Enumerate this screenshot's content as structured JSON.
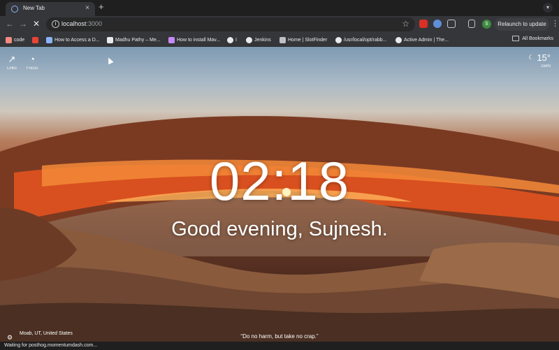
{
  "browser": {
    "tab": {
      "title": "New Tab",
      "close_glyph": "×"
    },
    "new_tab_glyph": "+",
    "tab_search_glyph": "▾",
    "nav": {
      "back": "←",
      "forward": "→",
      "stop": "✕"
    },
    "omnibox": {
      "info_glyph": "i",
      "host": "localhost",
      "port": ":3000",
      "star_glyph": "☆"
    },
    "profile_initial": "S",
    "relaunch_label": "Relaunch to update",
    "menu_glyph": "⋮",
    "bookmarks": [
      {
        "label": "code",
        "icon": "code-icon",
        "color": "#f28b82"
      },
      {
        "label": "",
        "icon": "red-app-icon",
        "color": "#ea4335"
      },
      {
        "label": "How to Access a D...",
        "icon": "link-icon",
        "color": "#8ab4f8"
      },
      {
        "label": "Madhu Pathy – Me...",
        "icon": "medium-icon",
        "color": "#e8eaed"
      },
      {
        "label": "How to install Mav...",
        "icon": "page-icon",
        "color": "#c58af9"
      },
      {
        "label": "I",
        "icon": "github-icon",
        "color": "#e8eaed"
      },
      {
        "label": "Jenkins",
        "icon": "google-icon",
        "color": "#e8eaed"
      },
      {
        "label": "Home | SlotFinder",
        "icon": "slotfinder-icon",
        "color": "#bdc1c6"
      },
      {
        "label": "/usr/local/opt/rabb...",
        "icon": "github-icon",
        "color": "#e8eaed"
      },
      {
        "label": "Active Admin | The...",
        "icon": "globe-icon",
        "color": "#e8eaed"
      }
    ],
    "all_bookmarks_label": "All Bookmarks"
  },
  "momentum": {
    "links": {
      "label": "Links",
      "glyph": "↗"
    },
    "focus": {
      "label": "Focus",
      "glyph": "◔"
    },
    "weather": {
      "glyph": "☾",
      "temperature": "15°",
      "city": "Delhi"
    },
    "clock": "02:18",
    "greeting": "Good evening, Sujnesh.",
    "quote": "“Do no harm, but take no crap.”",
    "photo_location": "Moab, UT, United States",
    "settings_glyph": "⚙"
  },
  "status_text": "Waiting for posthog.momentumdash.com..."
}
